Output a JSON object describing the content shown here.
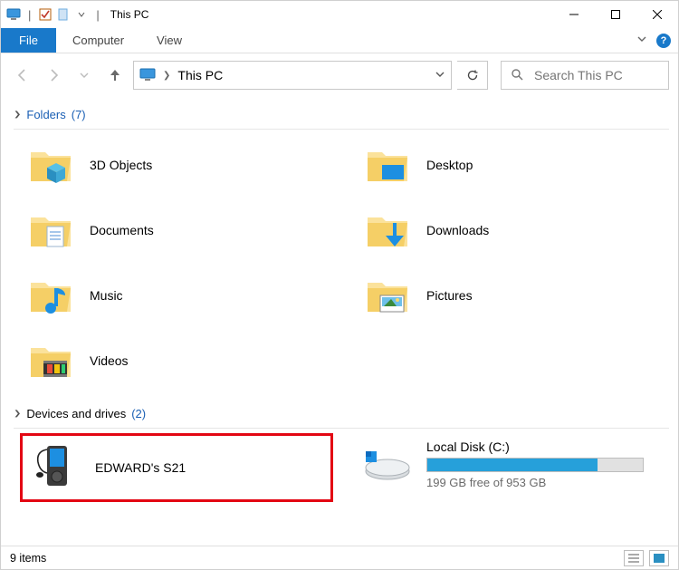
{
  "titlebar": {
    "title": "This PC"
  },
  "ribbon": {
    "file": "File",
    "tabs": [
      "Computer",
      "View"
    ]
  },
  "address": {
    "location": "This PC"
  },
  "search": {
    "placeholder": "Search This PC"
  },
  "sections": {
    "folders": {
      "label": "Folders",
      "count": "(7)",
      "items": [
        {
          "label": "3D Objects",
          "overlay": "3d"
        },
        {
          "label": "Desktop",
          "overlay": "desktop"
        },
        {
          "label": "Documents",
          "overlay": "doc"
        },
        {
          "label": "Downloads",
          "overlay": "download"
        },
        {
          "label": "Music",
          "overlay": "music"
        },
        {
          "label": "Pictures",
          "overlay": "pictures"
        },
        {
          "label": "Videos",
          "overlay": "video"
        }
      ]
    },
    "drives": {
      "label": "Devices and drives",
      "count": "(2)",
      "items": [
        {
          "label": "EDWARD's S21",
          "type": "device",
          "highlighted": true
        },
        {
          "label": "Local Disk (C:)",
          "type": "disk",
          "free_text": "199 GB free of 953 GB",
          "fill_percent": 79
        }
      ]
    }
  },
  "statusbar": {
    "item_count": "9 items"
  }
}
